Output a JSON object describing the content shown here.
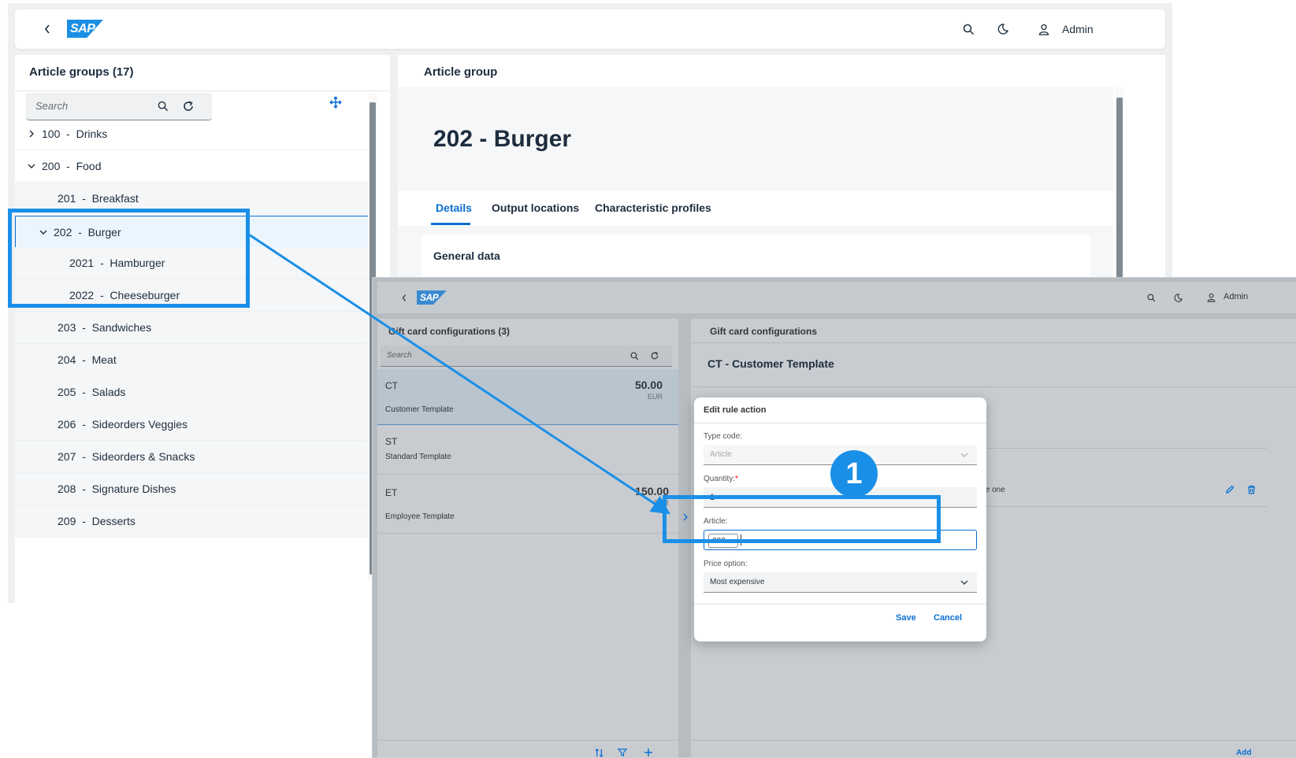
{
  "screen1": {
    "shellbar": {
      "user": "Admin",
      "logo": "SAP"
    },
    "left_panel": {
      "title": "Article groups (17)",
      "search_placeholder": "Search",
      "tree": [
        {
          "code": "100",
          "name": "Drinks",
          "expanded": false
        },
        {
          "code": "200",
          "name": "Food",
          "expanded": true
        },
        {
          "code": "201",
          "name": "Breakfast"
        },
        {
          "code": "202",
          "name": "Burger",
          "expanded": true,
          "selected": true
        },
        {
          "code": "2021",
          "name": "Hamburger"
        },
        {
          "code": "2022",
          "name": "Cheeseburger"
        },
        {
          "code": "203",
          "name": "Sandwiches"
        },
        {
          "code": "204",
          "name": "Meat"
        },
        {
          "code": "205",
          "name": "Salads"
        },
        {
          "code": "206",
          "name": "Sideorders Veggies"
        },
        {
          "code": "207",
          "name": "Sideorders & Snacks"
        },
        {
          "code": "208",
          "name": "Signature Dishes"
        },
        {
          "code": "209",
          "name": "Desserts"
        }
      ],
      "separator": "-"
    },
    "right_panel": {
      "title": "Article group",
      "object_title": "202 - Burger",
      "tabs": [
        "Details",
        "Output locations",
        "Characteristic profiles"
      ],
      "active_tab": "Details",
      "section_title": "General data"
    }
  },
  "screen2": {
    "shellbar": {
      "user": "Admin",
      "logo": "SAP"
    },
    "left_panel": {
      "title": "Gift card configurations (3)",
      "search_placeholder": "Search",
      "items": [
        {
          "code": "CT",
          "description": "Customer Template",
          "amount": "50.00",
          "currency": "EUR"
        },
        {
          "code": "ST",
          "description": "Standard Template",
          "amount": "",
          "currency": ""
        },
        {
          "code": "ET",
          "description": "Employee Template",
          "amount": "150.00",
          "currency": "EUR"
        }
      ]
    },
    "right_panel": {
      "title": "Gift card configurations",
      "object_title": "CT - Customer Template",
      "row_fragment": "nsive one",
      "add_label": "Add"
    },
    "dialog": {
      "title": "Edit rule action",
      "type_code_label": "Type code:",
      "type_code_value": "Article",
      "quantity_label": "Quantity:",
      "required_mark": "*",
      "quantity_value": "1",
      "article_label": "Article:",
      "article_token": "202",
      "price_option_label": "Price option:",
      "price_option_value": "Most expensive",
      "save_label": "Save",
      "cancel_label": "Cancel"
    }
  },
  "callout_number": "1",
  "colors": {
    "accent": "#1a8fe8",
    "sap_blue": "#0a6ed1"
  }
}
